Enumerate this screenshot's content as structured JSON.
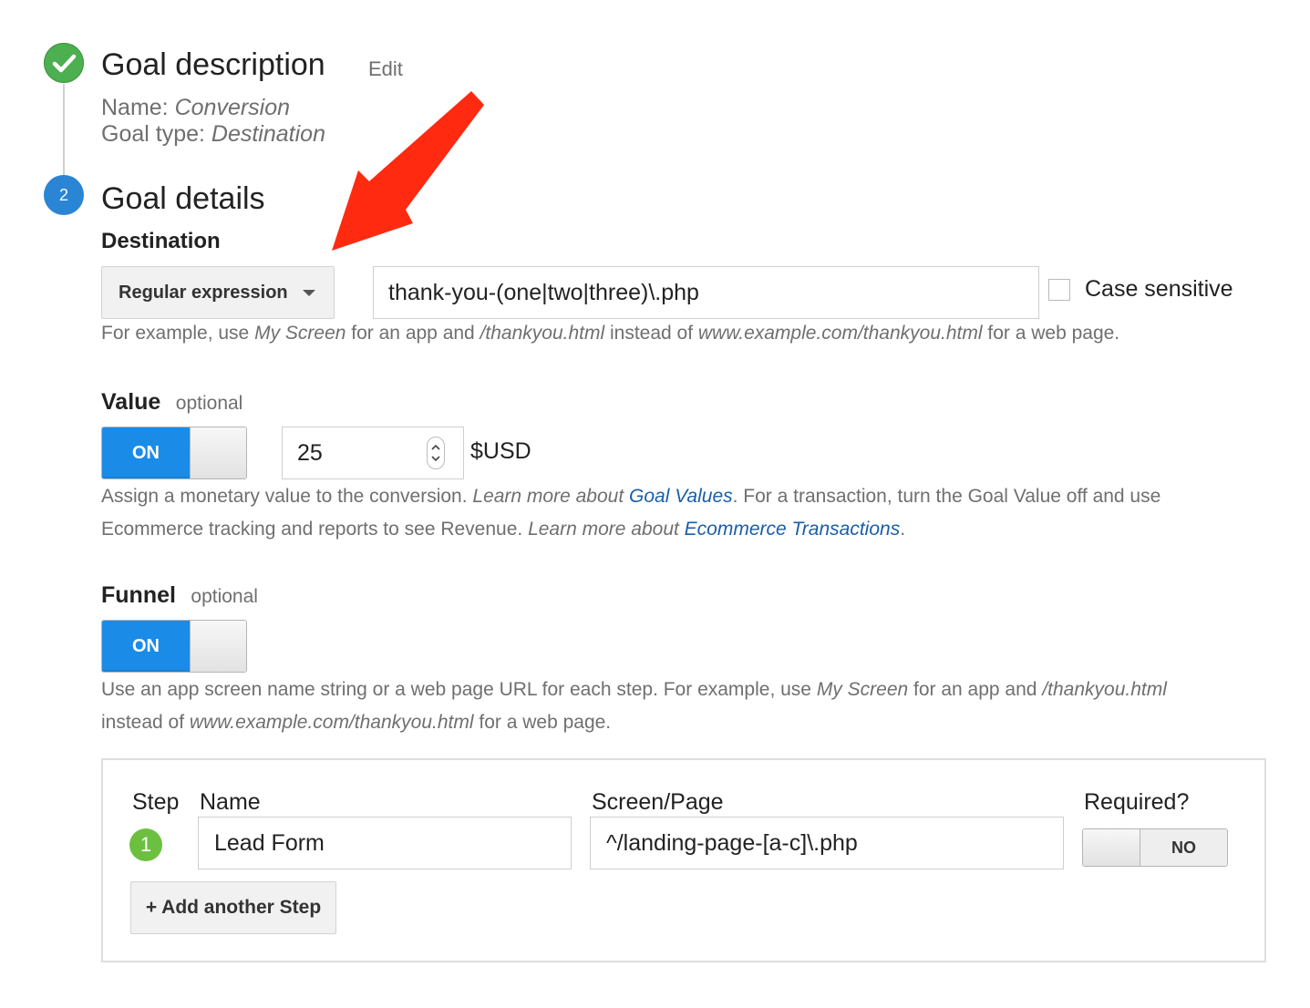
{
  "step1": {
    "title": "Goal description",
    "edit_label": "Edit",
    "name_label": "Name:",
    "name_value": "Conversion",
    "type_label": "Goal type:",
    "type_value": "Destination"
  },
  "step2": {
    "number": "2",
    "title": "Goal details"
  },
  "destination": {
    "label": "Destination",
    "match_type": "Regular expression",
    "value": "thank-you-(one|two|three)\\.php",
    "case_sensitive_label": "Case sensitive",
    "case_sensitive_checked": false,
    "help": {
      "p1": "For example, use ",
      "i1": "My Screen",
      "p2": " for an app and ",
      "i2": "/thankyou.html",
      "p3": " instead of ",
      "i3": "www.example.com/thankyou.html",
      "p4": " for a web page."
    }
  },
  "value_section": {
    "label": "Value",
    "optional": "optional",
    "toggle_label": "ON",
    "amount": "25",
    "currency": "$USD",
    "help": {
      "p1": "Assign a monetary value to the conversion. ",
      "i1": "Learn more about ",
      "link1": "Goal Values",
      "p2": ". For a transaction, turn the Goal Value off and use",
      "p3": "Ecommerce tracking and reports to see Revenue. ",
      "i2": "Learn more about ",
      "link2": "Ecommerce Transactions",
      "p4": "."
    }
  },
  "funnel": {
    "label": "Funnel",
    "optional": "optional",
    "toggle_label": "ON",
    "help": {
      "p1": "Use an app screen name string or a web page URL for each step. For example, use ",
      "i1": "My Screen",
      "p2": " for an app and ",
      "i2": "/thankyou.html",
      "p3": "instead of ",
      "i3": "www.example.com/thankyou.html",
      "p4": " for a web page."
    },
    "table": {
      "col_step": "Step",
      "col_name": "Name",
      "col_page": "Screen/Page",
      "col_required": "Required?",
      "row": {
        "step": "1",
        "name": "Lead Form",
        "page": "^/landing-page-[a-c]\\.php",
        "required": "NO"
      },
      "add_button": "+ Add another Step"
    }
  },
  "colors": {
    "accent_blue": "#1a8ce8",
    "link_blue": "#1a5ea8",
    "success_green": "#4caf50",
    "step_blue": "#2a85d4",
    "arrow_red": "#ff2a10"
  }
}
